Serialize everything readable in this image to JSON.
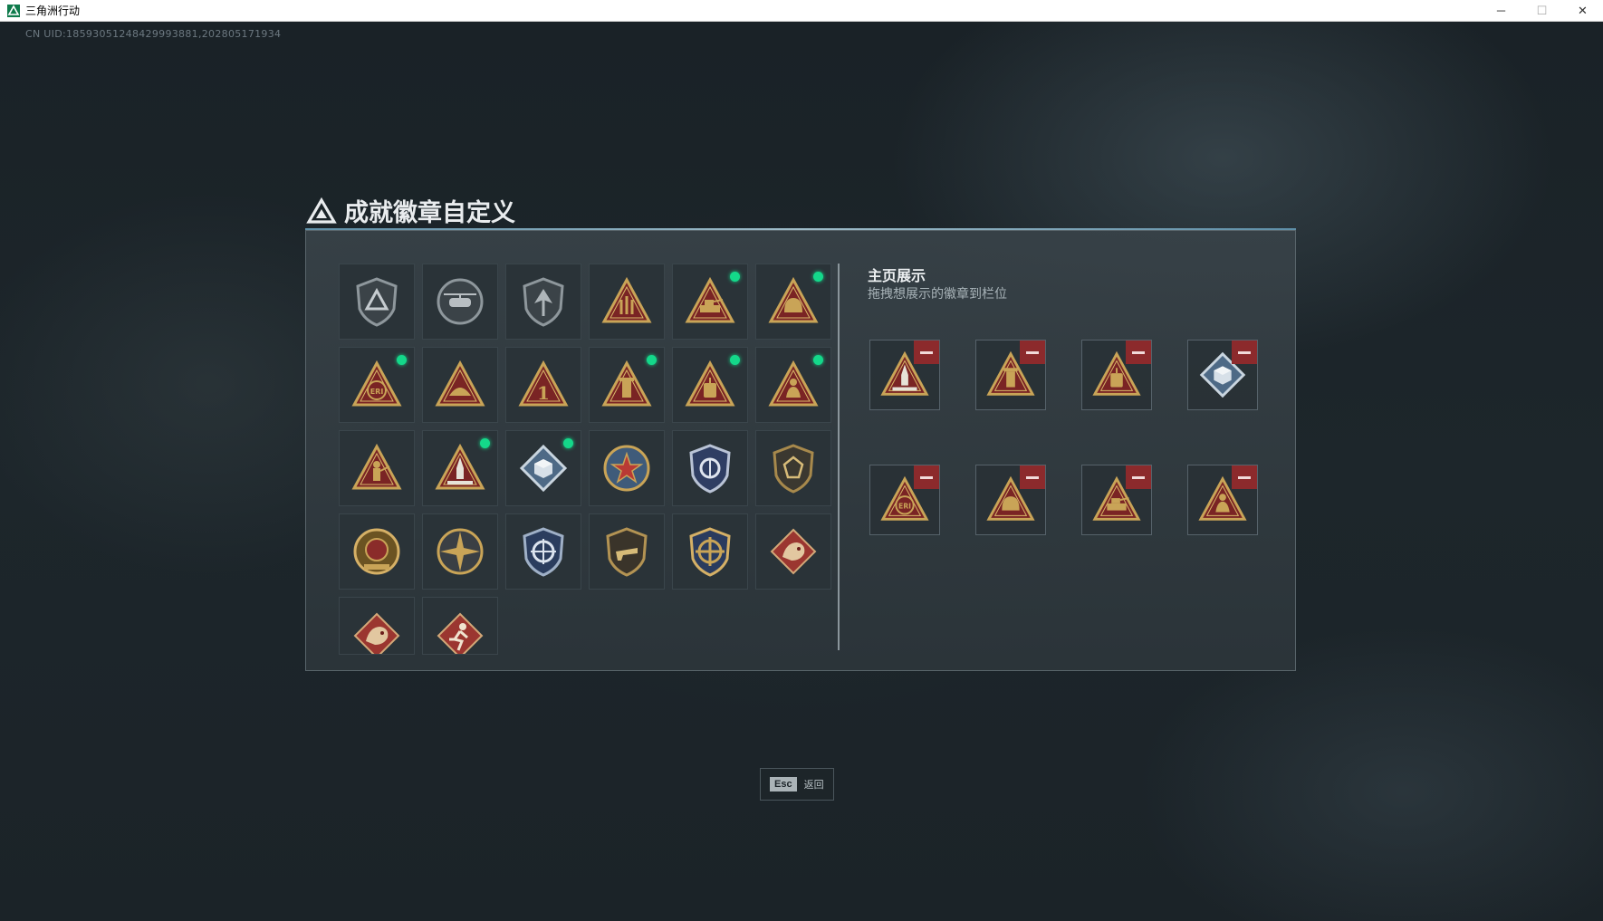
{
  "window": {
    "title": "三角洲行动",
    "controls": {
      "minimize": "─",
      "maximize": "☐",
      "close": "✕"
    }
  },
  "uid": "CN UID:18593051248429993881,202805171934",
  "dialog": {
    "title": "成就徽章自定义"
  },
  "badges": [
    {
      "id": "b01",
      "icon": "shield-triangle-icon",
      "new": false
    },
    {
      "id": "b02",
      "icon": "helicopter-icon",
      "new": false
    },
    {
      "id": "b03",
      "icon": "shield-arrow-icon",
      "new": false
    },
    {
      "id": "b04",
      "icon": "rock-hand-icon",
      "new": false
    },
    {
      "id": "b05",
      "icon": "tank-icon",
      "new": true
    },
    {
      "id": "b06",
      "icon": "helmet-icon",
      "new": true
    },
    {
      "id": "b07",
      "icon": "eri-globe-icon",
      "new": true
    },
    {
      "id": "b08",
      "icon": "taco-icon",
      "new": false
    },
    {
      "id": "b09",
      "icon": "number-one-icon",
      "new": false
    },
    {
      "id": "b10",
      "icon": "tower-icon",
      "new": true
    },
    {
      "id": "b11",
      "icon": "lantern-icon",
      "new": true
    },
    {
      "id": "b12",
      "icon": "sitting-figure-icon",
      "new": true
    },
    {
      "id": "b13",
      "icon": "soldier-icon",
      "new": false
    },
    {
      "id": "b14",
      "icon": "rocket-icon",
      "new": true
    },
    {
      "id": "b15",
      "icon": "cube-icon",
      "new": true
    },
    {
      "id": "b16",
      "icon": "star-emblem-icon",
      "new": false
    },
    {
      "id": "b17",
      "icon": "police-badge-icon",
      "new": false
    },
    {
      "id": "b18",
      "icon": "gem-shield-icon",
      "new": false
    },
    {
      "id": "b19",
      "icon": "eagle-crest-icon",
      "new": false
    },
    {
      "id": "b20",
      "icon": "compass-star-icon",
      "new": false
    },
    {
      "id": "b21",
      "icon": "crosshair-shield-icon",
      "new": false
    },
    {
      "id": "b22",
      "icon": "gun-shield-icon",
      "new": false
    },
    {
      "id": "b23",
      "icon": "gold-crosshair-icon",
      "new": false
    },
    {
      "id": "b24",
      "icon": "dragon-icon",
      "new": false
    },
    {
      "id": "b25",
      "icon": "dragon-icon",
      "new": false
    },
    {
      "id": "b26",
      "icon": "runner-icon",
      "new": false
    }
  ],
  "showcase": {
    "title": "主页展示",
    "subtitle": "拖拽想展示的徽章到栏位",
    "slots": [
      {
        "icon": "rocket-icon"
      },
      {
        "icon": "tower-icon"
      },
      {
        "icon": "lantern-icon"
      },
      {
        "icon": "cube-icon"
      },
      {
        "icon": "eri-globe-icon"
      },
      {
        "icon": "helmet-icon"
      },
      {
        "icon": "tank-icon"
      },
      {
        "icon": "sitting-figure-icon"
      }
    ]
  },
  "footer": {
    "key": "Esc",
    "label": "返回"
  },
  "colors": {
    "gold": "#c9a457",
    "dark_red": "#7a2424",
    "new_dot": "#14d88a",
    "remove_btn": "#8c2a2c"
  }
}
